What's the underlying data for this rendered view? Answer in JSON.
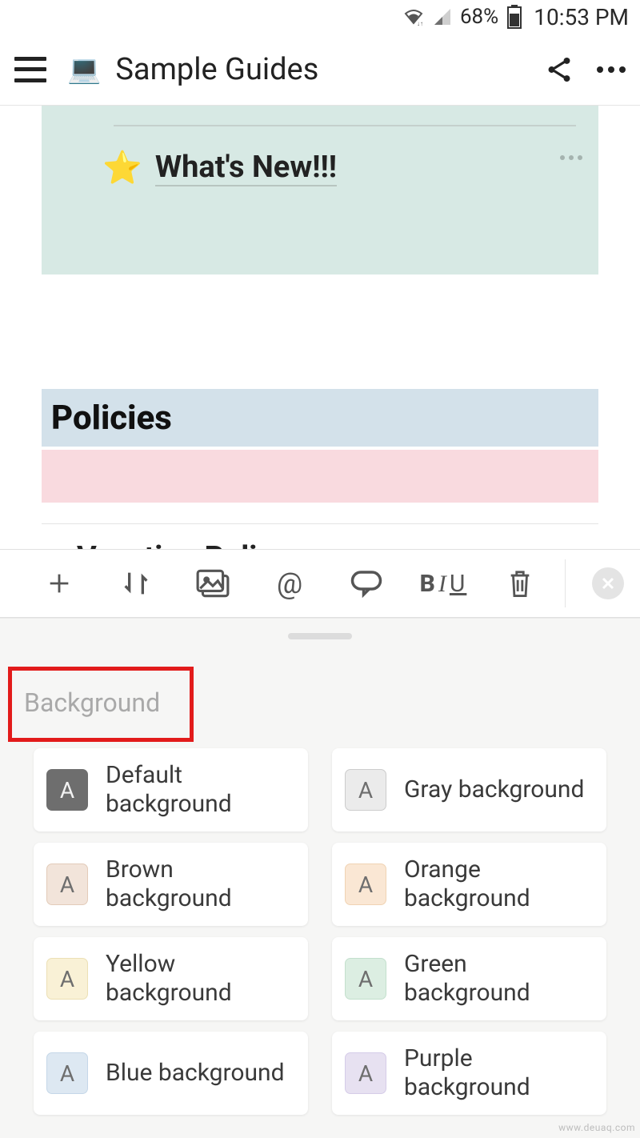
{
  "status_bar": {
    "battery_pct": "68%",
    "time": "10:53 PM"
  },
  "header": {
    "title": "Sample Guides"
  },
  "content": {
    "whats_new": "What's New!!!",
    "policies_heading": "Policies",
    "vacation_policy": "Vacation Policy"
  },
  "toolbar": {
    "add": "add",
    "move": "move",
    "image": "image",
    "mention": "@",
    "comment": "comment",
    "format": "BIU",
    "delete": "delete",
    "close": "close"
  },
  "panel": {
    "section_label": "Background",
    "options": [
      {
        "label": "Default background",
        "swatch": "default",
        "glyph": "A"
      },
      {
        "label": "Gray background",
        "swatch": "gray",
        "glyph": "A"
      },
      {
        "label": "Brown background",
        "swatch": "brown",
        "glyph": "A"
      },
      {
        "label": "Orange background",
        "swatch": "orange",
        "glyph": "A"
      },
      {
        "label": "Yellow background",
        "swatch": "yellow",
        "glyph": "A"
      },
      {
        "label": "Green background",
        "swatch": "green",
        "glyph": "A"
      },
      {
        "label": "Blue background",
        "swatch": "blue",
        "glyph": "A"
      },
      {
        "label": "Purple background",
        "swatch": "purple",
        "glyph": "A"
      }
    ]
  },
  "watermark": "www.deuaq.com"
}
